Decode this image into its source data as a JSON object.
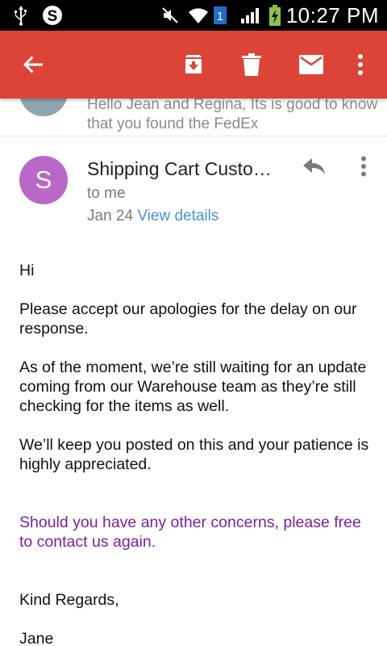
{
  "status_bar": {
    "time": "10:27 PM",
    "sim_slot": "1",
    "icons": [
      "usb-icon",
      "skype-icon",
      "mute-icon",
      "wifi-icon",
      "sim-icon",
      "signal-icon",
      "battery-charging-icon"
    ]
  },
  "app_bar": {
    "color": "#db4437",
    "actions": [
      "back-arrow-icon",
      "archive-icon",
      "delete-icon",
      "mark-unread-icon",
      "more-vert-icon"
    ]
  },
  "previous_message": {
    "snippet": "Hello Jean and Regina, Its is good to know that you found the FedEx"
  },
  "message": {
    "avatar_letter": "S",
    "avatar_color": "#ba68c8",
    "sender": "Shipping Cart Customer Service",
    "recipient": "to me",
    "date": "Jan 24",
    "view_details": "View details",
    "body": {
      "greeting": "Hi",
      "p1": "Please accept our apologies for the delay on our response.",
      "p2": "As of the moment, we’re still waiting for an update coming from our Warehouse team as they’re still checking for the items as well.",
      "p3": "We’ll keep you posted on this and your patience is highly appreciated.",
      "p4": "Should you have any other concerns, please free to contact us again.",
      "closing": "Kind Regards,",
      "signature": "Jane"
    }
  }
}
